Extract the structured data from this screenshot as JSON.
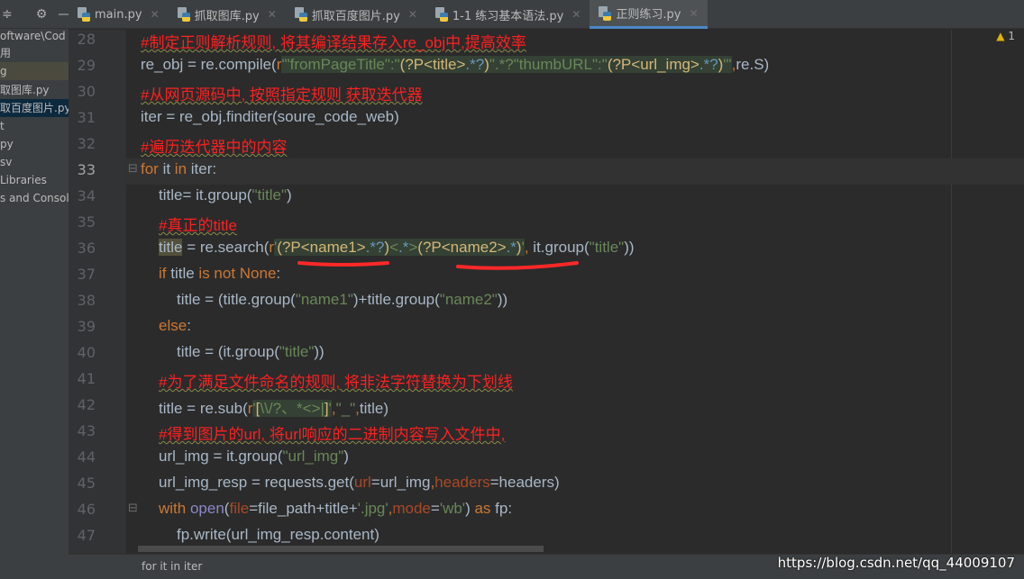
{
  "sidebar": {
    "items": [
      "oftware\\Cod",
      "用",
      "g",
      "取图库.py",
      "取百度图片.py",
      "t",
      "py",
      "sv",
      "Libraries",
      "s and Console"
    ]
  },
  "tabs": [
    {
      "label": "main.py"
    },
    {
      "label": "抓取图库.py"
    },
    {
      "label": "抓取百度图片.py"
    },
    {
      "label": "1-1 练习基本语法.py"
    },
    {
      "label": "正则练习.py",
      "active": true
    }
  ],
  "warnings": {
    "count": "1"
  },
  "current_line": 33,
  "colors": {
    "comment": "#ff2020",
    "string": "#6a8759",
    "keyword": "#cc7832",
    "default": "#a9b7c6",
    "background": "#2b2b2b"
  },
  "code": [
    {
      "n": "28",
      "i": 0,
      "t": [
        [
          "c",
          "#制定正则解析规则, 将其编译结果存入re_obj中,提高效率"
        ]
      ]
    },
    {
      "n": "29",
      "i": 0,
      "t": [
        [
          "d",
          "re_obj = re.compile("
        ],
        [
          "k",
          "r"
        ],
        [
          "sb",
          "'\"fromPageTitle\":\""
        ],
        [
          "rg",
          "(?P<title>"
        ],
        [
          "rm",
          ".*?"
        ],
        [
          "rg",
          ")"
        ],
        [
          "sb",
          "\".*?\"thumbURL\":\""
        ],
        [
          "rg",
          "(?P<url_img>"
        ],
        [
          "rm",
          ".*?"
        ],
        [
          "rg",
          ")"
        ],
        [
          "sb",
          "\"'"
        ],
        [
          "k",
          ","
        ],
        [
          "d",
          "re.S)"
        ]
      ]
    },
    {
      "n": "30",
      "i": 0,
      "t": [
        [
          "c",
          "#从网页源码中, 按照指定规则 获取迭代器"
        ]
      ]
    },
    {
      "n": "31",
      "i": 0,
      "t": [
        [
          "d",
          "iter = re_obj.finditer(soure_code_web)"
        ]
      ]
    },
    {
      "n": "32",
      "i": 0,
      "t": [
        [
          "c",
          "#遍历迭代器中的内容"
        ]
      ]
    },
    {
      "n": "33",
      "i": 0,
      "t": [
        [
          "k",
          "for "
        ],
        [
          "d",
          "it "
        ],
        [
          "k",
          "in "
        ],
        [
          "d",
          "iter:"
        ]
      ]
    },
    {
      "n": "34",
      "i": 1,
      "t": [
        [
          "d",
          "title= it.group("
        ],
        [
          "s",
          "\"title\""
        ],
        [
          "d",
          ")"
        ]
      ]
    },
    {
      "n": "35",
      "i": 1,
      "t": [
        [
          "c",
          "#真正的title"
        ]
      ]
    },
    {
      "n": "36",
      "i": 1,
      "t": [
        [
          "hl",
          "title"
        ],
        [
          "d",
          " = re.search("
        ],
        [
          "k",
          "r"
        ],
        [
          "sb",
          "'"
        ],
        [
          "rg",
          "(?P<name1>"
        ],
        [
          "rm",
          ".*?"
        ],
        [
          "rg",
          ")"
        ],
        [
          "sb",
          "<"
        ],
        [
          "rm",
          ".*"
        ],
        [
          "sb",
          ">"
        ],
        [
          "rg",
          "(?P<name2>"
        ],
        [
          "rm",
          ".*"
        ],
        [
          "rg",
          ")"
        ],
        [
          "sb",
          "'"
        ],
        [
          "k",
          ", "
        ],
        [
          "d",
          "it.group("
        ],
        [
          "s",
          "\"title\""
        ],
        [
          "d",
          "))"
        ]
      ]
    },
    {
      "n": "37",
      "i": 1,
      "t": [
        [
          "k",
          "if "
        ],
        [
          "d",
          "title "
        ],
        [
          "k",
          "is not None"
        ],
        [
          "d",
          ":"
        ]
      ]
    },
    {
      "n": "38",
      "i": 2,
      "t": [
        [
          "d",
          "title = (title.group("
        ],
        [
          "s",
          "\"name1\""
        ],
        [
          "d",
          ")+title.group("
        ],
        [
          "s",
          "\"name2\""
        ],
        [
          "d",
          "))"
        ]
      ]
    },
    {
      "n": "39",
      "i": 1,
      "t": [
        [
          "k",
          "else"
        ],
        [
          "d",
          ":"
        ]
      ]
    },
    {
      "n": "40",
      "i": 2,
      "t": [
        [
          "d",
          "title = (it.group("
        ],
        [
          "s",
          "\"title\""
        ],
        [
          "d",
          "))"
        ]
      ]
    },
    {
      "n": "41",
      "i": 1,
      "t": [
        [
          "c",
          "#为了满足文件命名的规则, 将非法字符替换为下划线"
        ]
      ]
    },
    {
      "n": "42",
      "i": 1,
      "t": [
        [
          "d",
          "title = re.sub("
        ],
        [
          "k",
          "r"
        ],
        [
          "sb",
          "'"
        ],
        [
          "rg",
          "["
        ],
        [
          "sb",
          "\\\\/?、*<>|"
        ],
        [
          "rg",
          "]"
        ],
        [
          "sb",
          "'"
        ],
        [
          "k",
          ","
        ],
        [
          "s",
          "\"_\""
        ],
        [
          "k",
          ","
        ],
        [
          "d",
          "title)"
        ]
      ]
    },
    {
      "n": "43",
      "i": 1,
      "t": [
        [
          "c",
          "#得到图片的url, 将url响应的二进制内容写入文件中,"
        ]
      ]
    },
    {
      "n": "44",
      "i": 1,
      "t": [
        [
          "d",
          "url_img = it.group("
        ],
        [
          "s",
          "\"url_img\""
        ],
        [
          "d",
          ")"
        ]
      ]
    },
    {
      "n": "45",
      "i": 1,
      "t": [
        [
          "d",
          "url_img_resp = requests.get("
        ],
        [
          "p",
          "url"
        ],
        [
          "d",
          "=url_img"
        ],
        [
          "k",
          ","
        ],
        [
          "p",
          "headers"
        ],
        [
          "d",
          "=headers)"
        ]
      ]
    },
    {
      "n": "46",
      "i": 1,
      "t": [
        [
          "k",
          "with "
        ],
        [
          "b",
          "open"
        ],
        [
          "d",
          "("
        ],
        [
          "p",
          "file"
        ],
        [
          "d",
          "=file_path+title+"
        ],
        [
          "s",
          "'.jpg'"
        ],
        [
          "k",
          ","
        ],
        [
          "p",
          "mode"
        ],
        [
          "d",
          "="
        ],
        [
          "s",
          "'wb'"
        ],
        [
          "d",
          ") "
        ],
        [
          "k",
          "as "
        ],
        [
          "d",
          "fp:"
        ]
      ]
    },
    {
      "n": "47",
      "i": 2,
      "t": [
        [
          "d",
          "fp.write(url_img_resp.content)"
        ]
      ]
    }
  ],
  "status": {
    "breadcrumb": "for it in iter"
  },
  "watermark": "https://blog.csdn.net/qq_44009107"
}
